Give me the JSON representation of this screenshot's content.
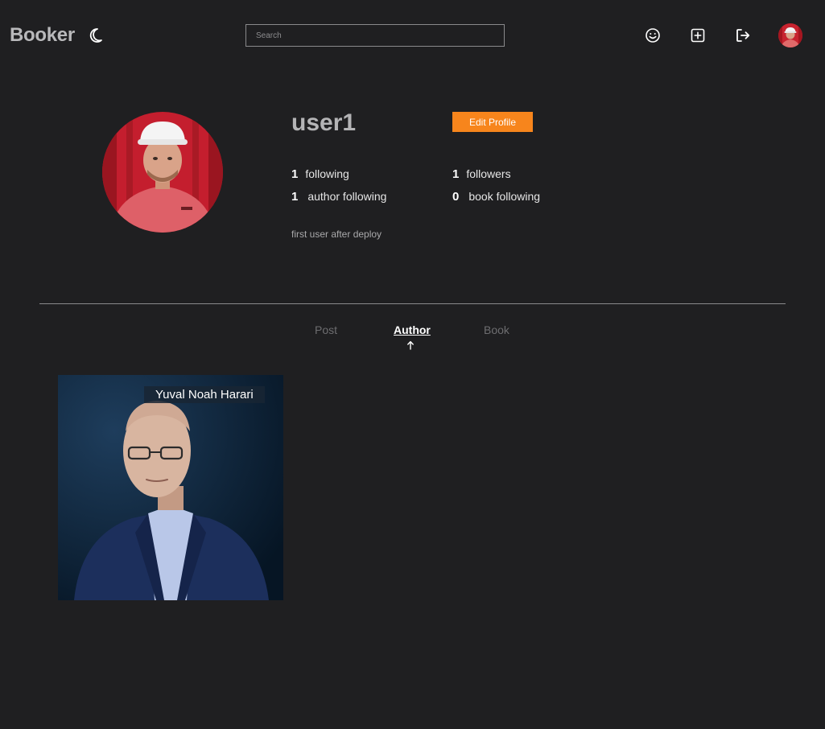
{
  "header": {
    "brand": "Booker",
    "search_placeholder": "Search",
    "icons": [
      "moon-icon",
      "smile-icon",
      "plus-square-icon",
      "logout-icon",
      "avatar"
    ]
  },
  "profile": {
    "username": "user1",
    "edit_label": "Edit Profile",
    "stats": {
      "following": {
        "count": "1",
        "label": "following"
      },
      "followers": {
        "count": "1",
        "label": "followers"
      },
      "author_following": {
        "count": "1",
        "label": "author following"
      },
      "book_following": {
        "count": "0",
        "label": "book following"
      }
    },
    "bio": "first user after deploy"
  },
  "tabs": {
    "post": "Post",
    "author": "Author",
    "book": "Book",
    "active": "Author"
  },
  "authors": [
    {
      "name": "Yuval Noah Harari"
    }
  ],
  "colors": {
    "background": "#1f1f21",
    "accent": "#f7851c"
  }
}
